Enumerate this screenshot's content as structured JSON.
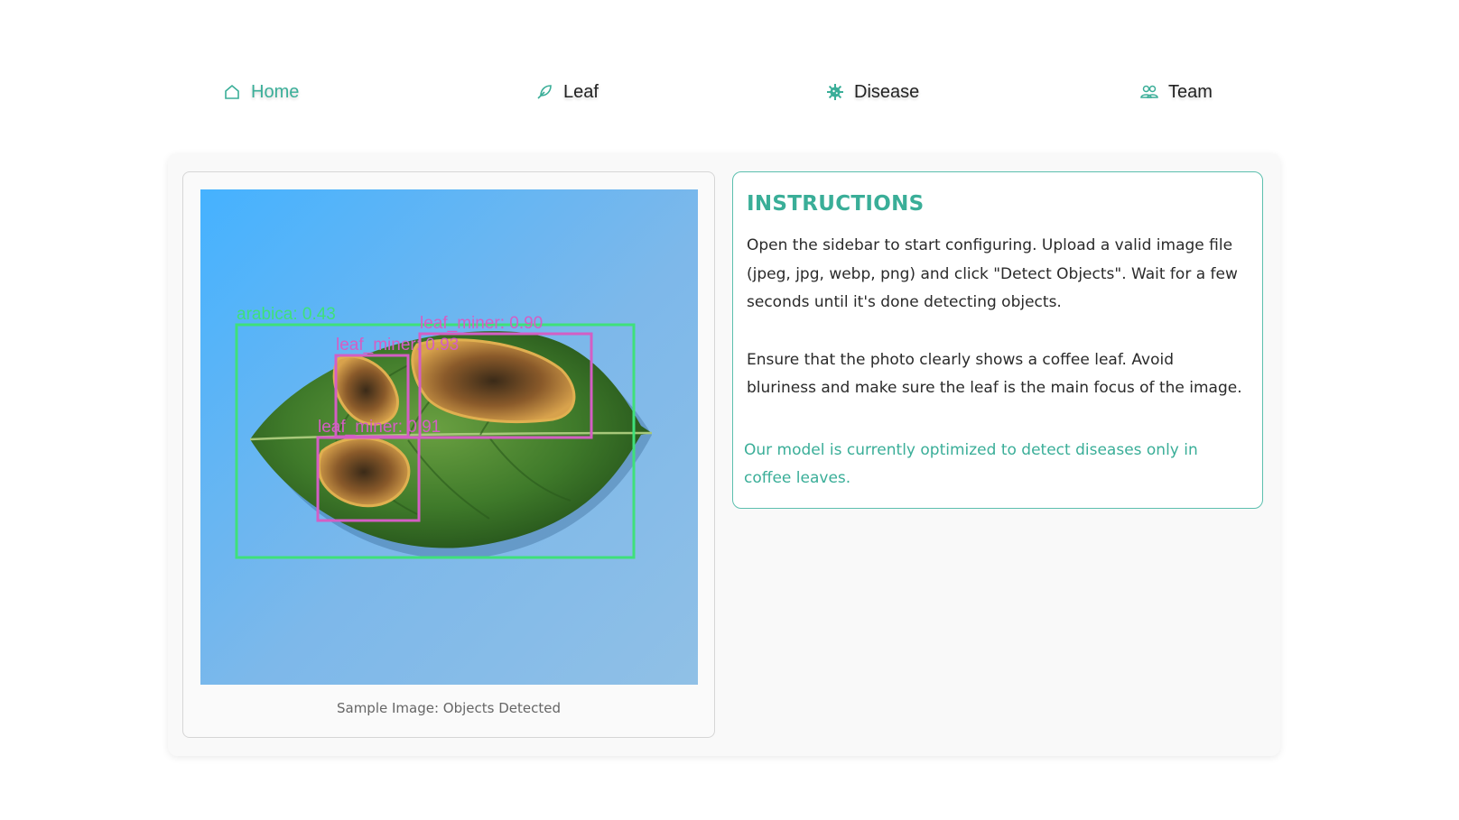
{
  "nav": {
    "items": [
      {
        "label": "Home",
        "icon": "home-icon",
        "active": true
      },
      {
        "label": "Leaf",
        "icon": "feather-icon",
        "active": false
      },
      {
        "label": "Disease",
        "icon": "virus-icon",
        "active": false
      },
      {
        "label": "Team",
        "icon": "people-icon",
        "active": false
      }
    ],
    "accent_color": "#3aae98"
  },
  "sample": {
    "caption": "Sample Image: Objects Detected",
    "detections": [
      {
        "label": "arabica: 0.43",
        "color": "#3fe07a"
      },
      {
        "label": "leaf_miner: 0.90",
        "color": "#d45ec4"
      },
      {
        "label": "leaf_miner: 0.93",
        "color": "#d45ec4"
      },
      {
        "label": "leaf_miner: 0.91",
        "color": "#d45ec4"
      }
    ]
  },
  "instructions": {
    "title": "INSTRUCTIONS",
    "paragraph1": "Open the sidebar to start configuring. Upload a valid image file (jpeg, jpg, webp, png) and click \"Detect Objects\". Wait for a few seconds until it's done detecting objects.",
    "paragraph2": "Ensure that the photo clearly shows a coffee leaf. Avoid bluriness and make sure the leaf is the main focus of the image.",
    "note": "Our model is currently optimized to detect diseases only in coffee leaves."
  }
}
